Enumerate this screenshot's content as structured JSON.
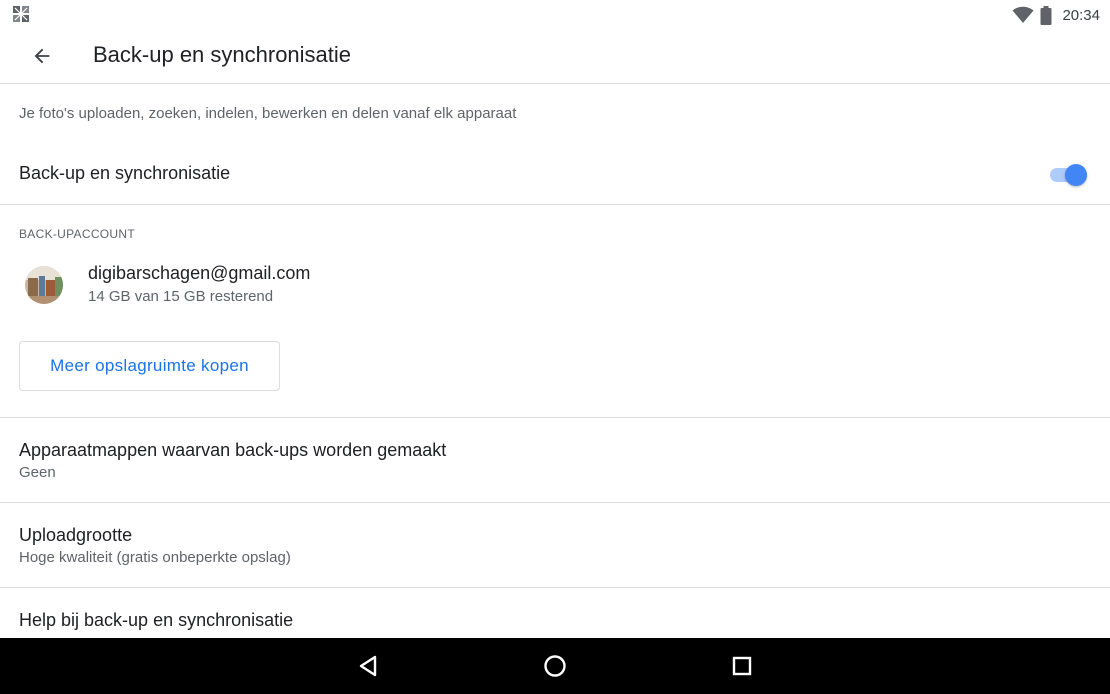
{
  "status_bar": {
    "time": "20:34",
    "left_icon": "photos-notification-icon",
    "icons": [
      "wifi-icon",
      "battery-icon"
    ]
  },
  "app_bar": {
    "back_icon": "arrow-back-icon",
    "title": "Back-up en synchronisatie"
  },
  "description": "Je foto's uploaden, zoeken, indelen, bewerken en delen vanaf elk apparaat",
  "sync_toggle": {
    "label": "Back-up en synchronisatie",
    "enabled": true
  },
  "account_section": {
    "header": "BACK-UPACCOUNT",
    "email": "digibarschagen@gmail.com",
    "storage": "14 GB van 15 GB resterend",
    "buy_button_label": "Meer opslagruimte kopen"
  },
  "settings": {
    "folders": {
      "title": "Apparaatmappen waarvan back-ups worden gemaakt",
      "subtitle": "Geen"
    },
    "upload_size": {
      "title": "Uploadgrootte",
      "subtitle": "Hoge kwaliteit (gratis onbeperkte opslag)"
    },
    "help": {
      "title": "Help bij back-up en synchronisatie"
    }
  },
  "nav_bar": {
    "icons": [
      "nav-back-icon",
      "nav-home-icon",
      "nav-recent-icon"
    ]
  },
  "colors": {
    "accent": "#1a73e8",
    "toggle_thumb": "#4285f4",
    "toggle_track": "#aecbfa",
    "divider": "#dadce0",
    "secondary_text": "#5f6368",
    "nav_bar": "#000000"
  }
}
